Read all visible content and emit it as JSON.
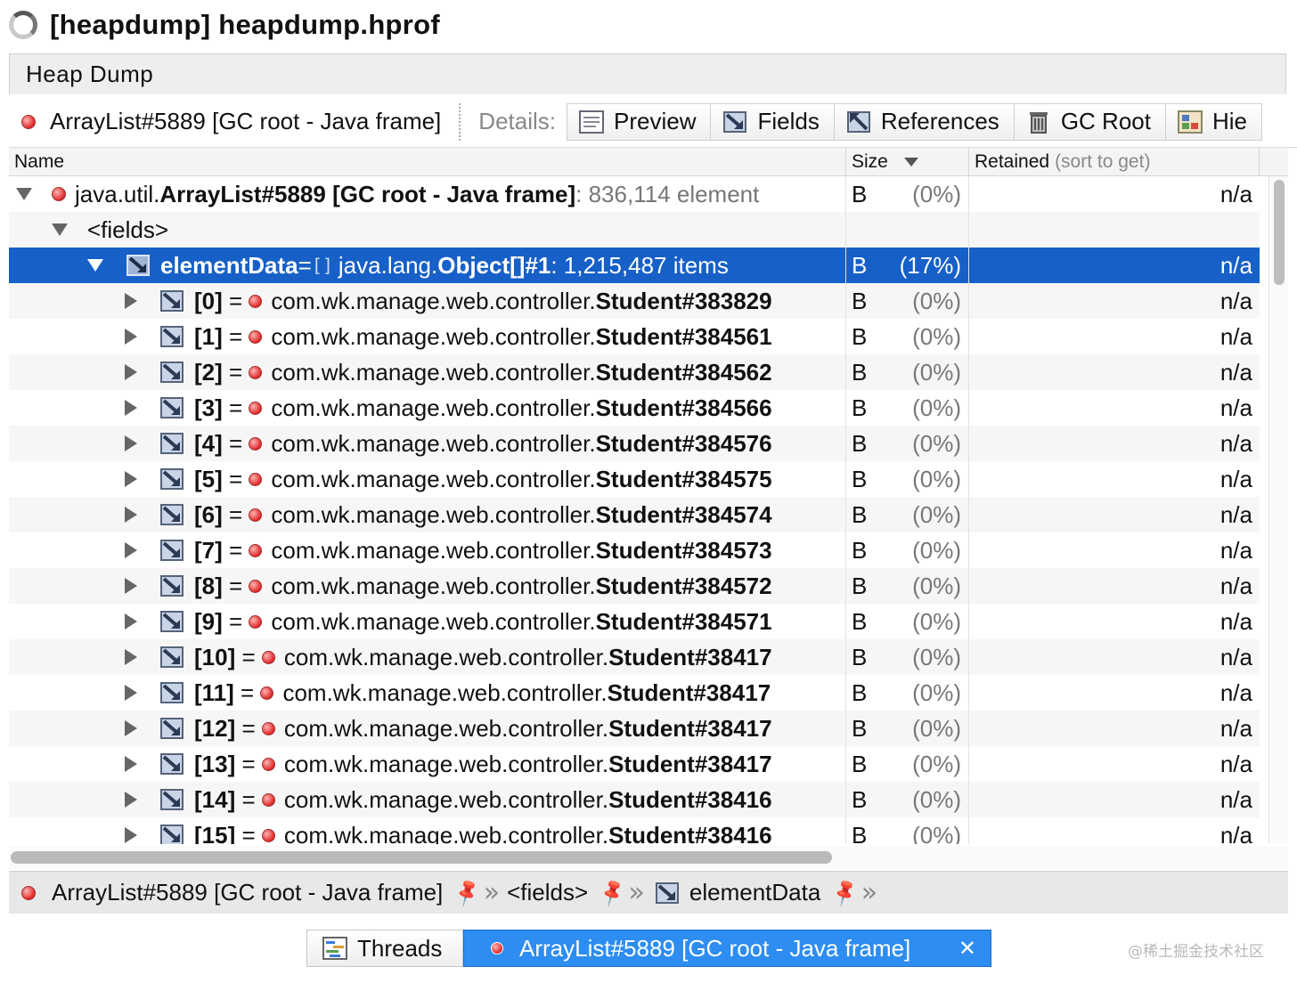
{
  "window": {
    "title": "[heapdump] heapdump.hprof"
  },
  "panel": {
    "title": "Heap Dump"
  },
  "toolbar": {
    "current_object": "ArrayList#5889 [GC root - Java frame]",
    "details_label": "Details:",
    "buttons": [
      "Preview",
      "Fields",
      "References",
      "GC Root",
      "Hie"
    ]
  },
  "table": {
    "columns": {
      "name": "Name",
      "size": "Size",
      "retained": "Retained",
      "retained_hint": "(sort to get)"
    },
    "root_row": {
      "pkg": "java.util.",
      "cls": "ArrayList#5889 [GC root - Java frame]",
      "suffix": " : 836,114 element",
      "size": "B",
      "pct": "(0%)",
      "retained": "n/a"
    },
    "fields_row": {
      "label": "<fields>"
    },
    "selected_row": {
      "field": "elementData",
      "eq": " = ",
      "arr_icon": "[]",
      "pkg": "java.lang.",
      "cls": "Object[]#1",
      "suffix": " : 1,215,487 items",
      "size": "B",
      "pct": "(17%)",
      "retained": "n/a"
    },
    "children": [
      {
        "index": "[0]",
        "pkg": "com.wk.manage.web.controller.",
        "cls": "Student#383829",
        "size": "B",
        "pct": "(0%)",
        "retained": "n/a"
      },
      {
        "index": "[1]",
        "pkg": "com.wk.manage.web.controller.",
        "cls": "Student#384561",
        "size": "B",
        "pct": "(0%)",
        "retained": "n/a"
      },
      {
        "index": "[2]",
        "pkg": "com.wk.manage.web.controller.",
        "cls": "Student#384562",
        "size": "B",
        "pct": "(0%)",
        "retained": "n/a"
      },
      {
        "index": "[3]",
        "pkg": "com.wk.manage.web.controller.",
        "cls": "Student#384566",
        "size": "B",
        "pct": "(0%)",
        "retained": "n/a"
      },
      {
        "index": "[4]",
        "pkg": "com.wk.manage.web.controller.",
        "cls": "Student#384576",
        "size": "B",
        "pct": "(0%)",
        "retained": "n/a"
      },
      {
        "index": "[5]",
        "pkg": "com.wk.manage.web.controller.",
        "cls": "Student#384575",
        "size": "B",
        "pct": "(0%)",
        "retained": "n/a"
      },
      {
        "index": "[6]",
        "pkg": "com.wk.manage.web.controller.",
        "cls": "Student#384574",
        "size": "B",
        "pct": "(0%)",
        "retained": "n/a"
      },
      {
        "index": "[7]",
        "pkg": "com.wk.manage.web.controller.",
        "cls": "Student#384573",
        "size": "B",
        "pct": "(0%)",
        "retained": "n/a"
      },
      {
        "index": "[8]",
        "pkg": "com.wk.manage.web.controller.",
        "cls": "Student#384572",
        "size": "B",
        "pct": "(0%)",
        "retained": "n/a"
      },
      {
        "index": "[9]",
        "pkg": "com.wk.manage.web.controller.",
        "cls": "Student#384571",
        "size": "B",
        "pct": "(0%)",
        "retained": "n/a"
      },
      {
        "index": "[10]",
        "pkg": "com.wk.manage.web.controller.",
        "cls": "Student#38417",
        "size": "B",
        "pct": "(0%)",
        "retained": "n/a"
      },
      {
        "index": "[11]",
        "pkg": "com.wk.manage.web.controller.",
        "cls": "Student#38417",
        "size": "B",
        "pct": "(0%)",
        "retained": "n/a"
      },
      {
        "index": "[12]",
        "pkg": "com.wk.manage.web.controller.",
        "cls": "Student#38417",
        "size": "B",
        "pct": "(0%)",
        "retained": "n/a"
      },
      {
        "index": "[13]",
        "pkg": "com.wk.manage.web.controller.",
        "cls": "Student#38417",
        "size": "B",
        "pct": "(0%)",
        "retained": "n/a"
      },
      {
        "index": "[14]",
        "pkg": "com.wk.manage.web.controller.",
        "cls": "Student#38416",
        "size": "B",
        "pct": "(0%)",
        "retained": "n/a"
      },
      {
        "index": "[15]",
        "pkg": "com.wk.manage.web.controller.",
        "cls": "Student#38416",
        "size": "B",
        "pct": "(0%)",
        "retained": "n/a"
      }
    ]
  },
  "breadcrumb": {
    "items": [
      "ArrayList#5889 [GC root - Java frame]",
      "<fields>",
      "elementData"
    ]
  },
  "bottom_tabs": {
    "threads": "Threads",
    "active": "ArrayList#5889 [GC root - Java frame]",
    "close": "✕"
  },
  "watermark": "@稀土掘金技术社区",
  "colors": {
    "selection": "#1660c7",
    "active_tab": "#2d8df0",
    "object_dot": "#e02828"
  },
  "icons": [
    "spinner-icon",
    "preview-icon",
    "fields-icon",
    "references-icon",
    "gc-root-icon",
    "hierarchy-icon",
    "object-icon",
    "field-icon",
    "array-icon",
    "pin-icon",
    "chevron-right-icon",
    "threads-icon",
    "close-icon"
  ]
}
